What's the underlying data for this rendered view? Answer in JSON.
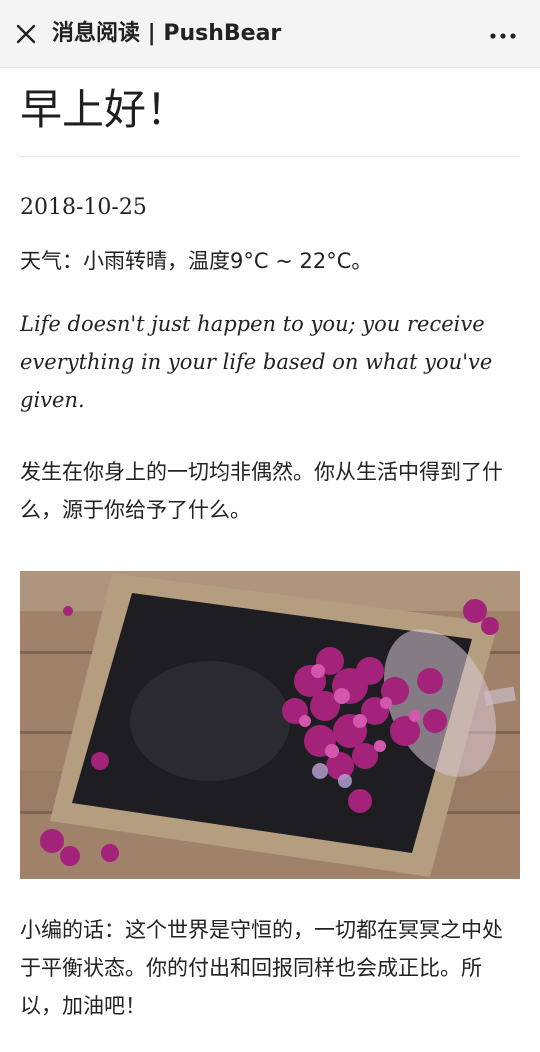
{
  "header": {
    "title": "消息阅读 | PushBear",
    "close_icon": "close-icon",
    "more_icon": "more-dots-icon"
  },
  "article": {
    "title": "早上好！",
    "date": "2018-10-25",
    "weather": "天气：小雨转晴，温度9°C ~ 22°C。",
    "quote_en": "Life doesn't just happen to you; you receive everything in your life based on what you've given.",
    "quote_cn": "发生在你身上的一切均非偶然。你从生活中得到了什么，源于你给予了什么。",
    "image_subject": "chalkboard with lilac flowers spilling from glass",
    "editor_note": "小编的话：这个世界是守恒的，一切都在冥冥之中处于平衡状态。你的付出和回报同样也会成正比。所以，加油吧！"
  },
  "colors": {
    "topbar_bg": "#f4f4f4",
    "text": "#222222",
    "divider": "#e5e5e5"
  }
}
